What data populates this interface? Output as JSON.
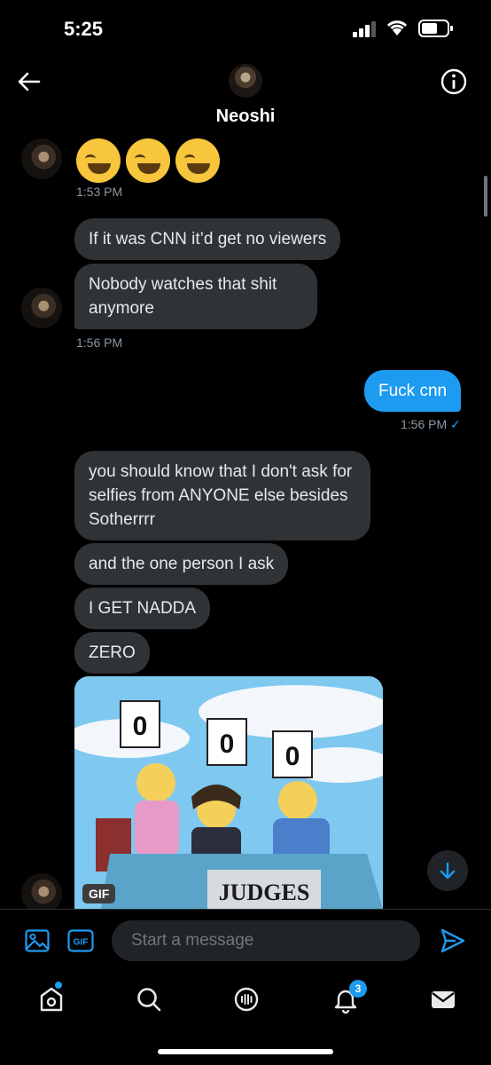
{
  "status_bar": {
    "time": "5:25"
  },
  "header": {
    "name": "Neoshi"
  },
  "messages": {
    "emoji_group": {
      "emojis": [
        "🤣",
        "🤣",
        "🤣"
      ],
      "time": "1:53 PM"
    },
    "group1": {
      "bubble1": "If it was CNN it’d get no viewers",
      "bubble2": "Nobody watches that shit anymore",
      "time": "1:56 PM"
    },
    "sent": {
      "text": "Fuck cnn",
      "time": "1:56 PM",
      "status": "✓"
    },
    "group2": {
      "bubble1": "you should know that I don't ask for selfies from ANYONE else besides Sotherrrr",
      "bubble2": "and the one person I ask",
      "bubble3": "I GET NADDA",
      "bubble4": "ZERO"
    },
    "gif": {
      "badge": "GIF",
      "score_cards": [
        "0",
        "0",
        "0"
      ],
      "banner_text": "JUDGES"
    }
  },
  "composer": {
    "placeholder": "Start a message",
    "gif_button": "GIF"
  },
  "tabbar": {
    "notifications_count": "3"
  },
  "colors": {
    "accent": "#1d9bf0",
    "bubble_in": "#2f3336",
    "background": "#000000"
  }
}
